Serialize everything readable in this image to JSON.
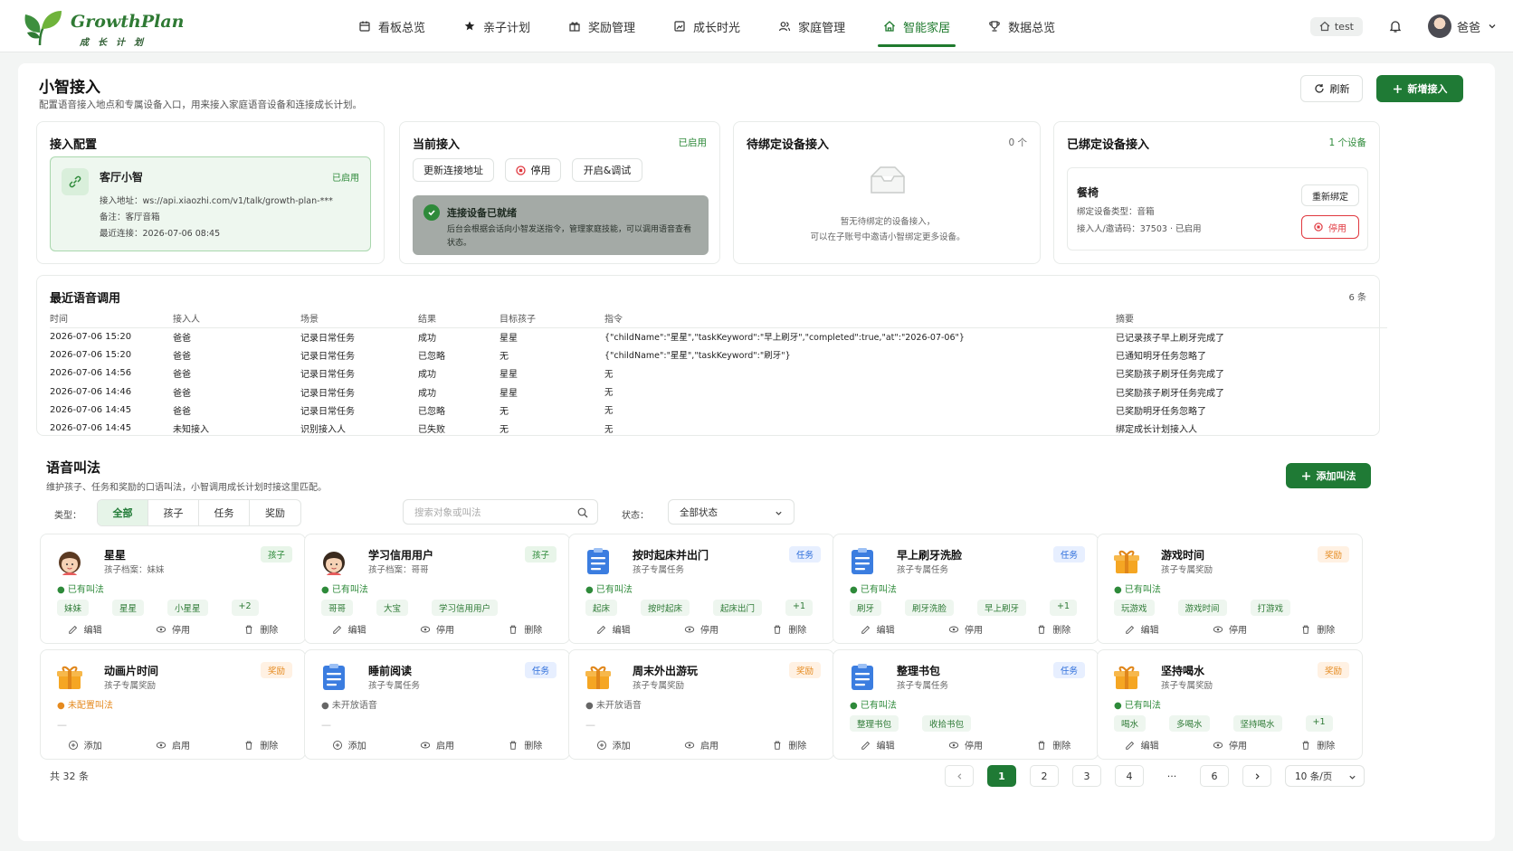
{
  "brand": {
    "name": "GrowthPlan",
    "subtitle": "成长计划"
  },
  "nav": [
    {
      "label": "看板总览",
      "icon": "calendar-icon"
    },
    {
      "label": "亲子计划",
      "icon": "star-icon"
    },
    {
      "label": "奖励管理",
      "icon": "gift-icon"
    },
    {
      "label": "成长时光",
      "icon": "photo-icon"
    },
    {
      "label": "家庭管理",
      "icon": "users-icon"
    },
    {
      "label": "智能家居",
      "icon": "home-icon",
      "active": true
    },
    {
      "label": "数据总览",
      "icon": "trophy-icon"
    }
  ],
  "header": {
    "env": "test",
    "user": "爸爸"
  },
  "page": {
    "title": "小智接入",
    "desc": "配置语音接入地点和专属设备入口，用来接入家庭语音设备和连接成长计划。",
    "refresh": "刷新",
    "add": "新增接入"
  },
  "config": {
    "title": "接入配置",
    "name": "客厅小智",
    "status": "已启用",
    "addr_label": "接入地址：",
    "addr": "ws://api.xiaozhi.com/v1/talk/growth-plan-***",
    "note_label": "备注：",
    "note": "客厅音箱",
    "last_label": "最近连接：",
    "last": "2026-07-06 08:45"
  },
  "current": {
    "title": "当前接入",
    "status": "已启用",
    "b1": "更新连接地址",
    "b2": "停用",
    "b3": "开启&调试",
    "ready_title": "连接设备已就绪",
    "ready_desc": "后台会根据会话向小智发送指令，管理家庭技能，可以调用语音查看状态。"
  },
  "pending": {
    "title": "待绑定设备接入",
    "count": "0 个",
    "empty1": "暂无待绑定的设备接入，",
    "empty2": "可以在子账号中邀请小智绑定更多设备。"
  },
  "bound": {
    "title": "已绑定设备接入",
    "count": "1 个设备",
    "name": "餐椅",
    "type_label": "绑定设备类型：",
    "type": "音箱",
    "who_label": "接入人/邀请码：",
    "who": "37503 · 已启用",
    "rebind": "重新绑定",
    "disable": "停用"
  },
  "recent": {
    "title": "最近语音调用",
    "count": "6 条",
    "cols": [
      "时间",
      "接入人",
      "场景",
      "结果",
      "目标孩子",
      "指令",
      "摘要"
    ],
    "rows": [
      [
        "2026-07-06 15:20",
        "爸爸",
        "记录日常任务",
        "成功",
        "星星",
        "{\"childName\":\"星星\",\"taskKeyword\":\"早上刷牙\",\"completed\":true,\"at\":\"2026-07-06\"}",
        "已记录孩子早上刷牙完成了"
      ],
      [
        "2026-07-06 15:20",
        "爸爸",
        "记录日常任务",
        "已忽略",
        "无",
        "{\"childName\":\"星星\",\"taskKeyword\":\"刷牙\"}",
        "已通知明牙任务忽略了"
      ],
      [
        "2026-07-06 14:56",
        "爸爸",
        "记录日常任务",
        "成功",
        "星星",
        "无",
        "已奖励孩子刷牙任务完成了"
      ],
      [
        "2026-07-06 14:46",
        "爸爸",
        "记录日常任务",
        "成功",
        "星星",
        "无",
        "已奖励孩子刷牙任务完成了"
      ],
      [
        "2026-07-06 14:45",
        "爸爸",
        "记录日常任务",
        "已忽略",
        "无",
        "无",
        "已奖励明牙任务忽略了"
      ],
      [
        "2026-07-06 14:45",
        "未知接入",
        "识别接入人",
        "已失败",
        "无",
        "无",
        "绑定成长计划接入人"
      ]
    ]
  },
  "voice": {
    "title": "语音叫法",
    "desc": "维护孩子、任务和奖励的口语叫法，小智调用成长计划时接这里匹配。",
    "add": "添加叫法",
    "type_label": "类型：",
    "types": [
      "全部",
      "孩子",
      "任务",
      "奖励"
    ],
    "search_ph": "搜索对象或叫法",
    "status_label": "状态：",
    "status_val": "全部状态"
  },
  "a": {
    "edit": "编辑",
    "disable": "停用",
    "del": "删除",
    "add": "添加",
    "enable": "启用"
  },
  "cards": [
    {
      "name": "星星",
      "sub": "孩子档案：妹妹",
      "badge": "孩子",
      "kind": "kid",
      "st": "已有叫法",
      "tags": [
        "妹妹",
        "星星",
        "小星星",
        "+2"
      ]
    },
    {
      "name": "学习信用用户",
      "sub": "孩子档案：哥哥",
      "badge": "孩子",
      "kind": "boy",
      "st": "已有叫法",
      "tags": [
        "哥哥",
        "大宝",
        "学习信用用户"
      ]
    },
    {
      "name": "按时起床并出门",
      "sub": "孩子专属任务",
      "badge": "任务",
      "kind": "task",
      "st": "已有叫法",
      "tags": [
        "起床",
        "按时起床",
        "起床出门",
        "+1"
      ]
    },
    {
      "name": "早上刷牙洗脸",
      "sub": "孩子专属任务",
      "badge": "任务",
      "kind": "task",
      "st": "已有叫法",
      "tags": [
        "刷牙",
        "刷牙洗脸",
        "早上刷牙",
        "+1"
      ]
    },
    {
      "name": "游戏时间",
      "sub": "孩子专属奖励",
      "badge": "奖励",
      "kind": "rew",
      "st": "已有叫法",
      "tags": [
        "玩游戏",
        "游戏时间",
        "打游戏"
      ]
    },
    {
      "name": "动画片时间",
      "sub": "孩子专属奖励",
      "badge": "奖励",
      "kind": "rew",
      "st": "未配置叫法",
      "tags": []
    },
    {
      "name": "睡前阅读",
      "sub": "孩子专属任务",
      "badge": "任务",
      "kind": "task",
      "st": "未开放语音",
      "tags": []
    },
    {
      "name": "周末外出游玩",
      "sub": "孩子专属奖励",
      "badge": "奖励",
      "kind": "rew",
      "st": "未开放语音",
      "tags": []
    },
    {
      "name": "整理书包",
      "sub": "孩子专属任务",
      "badge": "任务",
      "kind": "task",
      "st": "已有叫法",
      "tags": [
        "整理书包",
        "收拾书包"
      ]
    },
    {
      "name": "坚持喝水",
      "sub": "孩子专属奖励",
      "badge": "奖励",
      "kind": "rew",
      "st": "已有叫法",
      "tags": [
        "喝水",
        "多喝水",
        "坚持喝水",
        "+1"
      ]
    }
  ],
  "footer": {
    "total": "共 32 条",
    "pages": [
      "1",
      "2",
      "3",
      "4",
      "···",
      "6"
    ],
    "size": "10 条/页"
  },
  "colors": {
    "primary": "#1f7a35",
    "task": "#2f6fdb",
    "reward": "#e58a1f"
  }
}
